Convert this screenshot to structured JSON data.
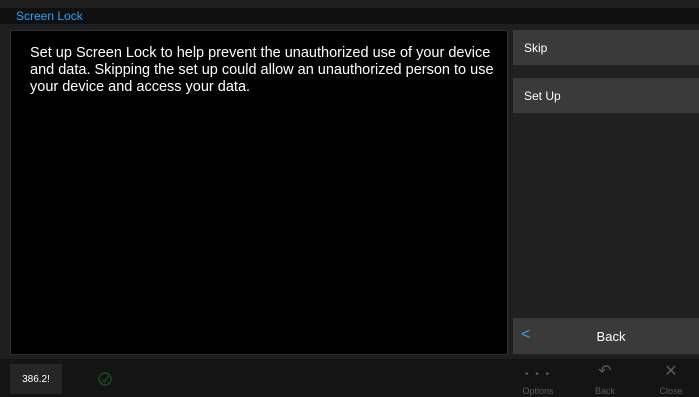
{
  "window": {
    "title": "Screen Lock"
  },
  "message": "Set up Screen Lock to help prevent the unauthorized use of your device and data. Skipping the set up could allow an unauthorized person to use your device and access your data.",
  "side_menu": {
    "skip_label": "Skip",
    "setup_label": "Set Up",
    "back_label": "Back",
    "back_icon": "chevron-left-icon"
  },
  "bottom_bar": {
    "frequency": "386.2!",
    "status_icon": "signal-icon",
    "options_label": "Options",
    "options_glyph": "• • •",
    "back_label": "Back",
    "back_glyph": "↶",
    "close_label": "Close",
    "close_glyph": "✕"
  },
  "colors": {
    "accent": "#29a3ff",
    "background": "#000000",
    "button": "#3a3a3a",
    "disabled": "#5a5a5a"
  }
}
